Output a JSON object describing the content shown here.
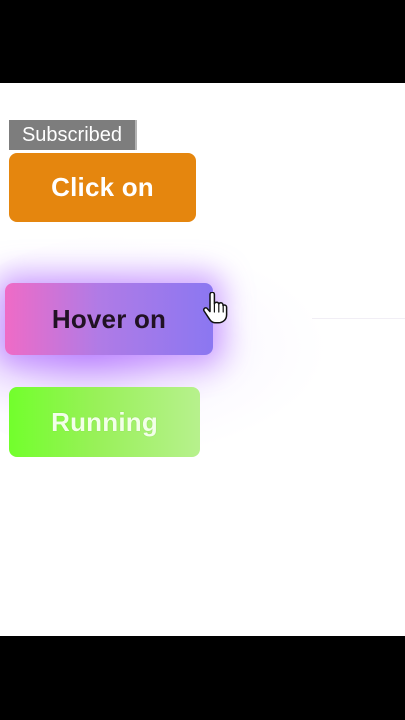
{
  "badge": {
    "label": "Subscribed"
  },
  "buttons": {
    "click": {
      "label": "Click on",
      "color": "#e5860e"
    },
    "hover": {
      "label": "Hover on",
      "gradient": [
        "#ef6bc6",
        "#8b77f1"
      ],
      "glow": "#a866ff"
    },
    "running": {
      "label": "Running",
      "gradient": [
        "#72ff2c",
        "#b7f18d"
      ]
    }
  },
  "cursor": {
    "icon": "hand-pointer-icon"
  }
}
